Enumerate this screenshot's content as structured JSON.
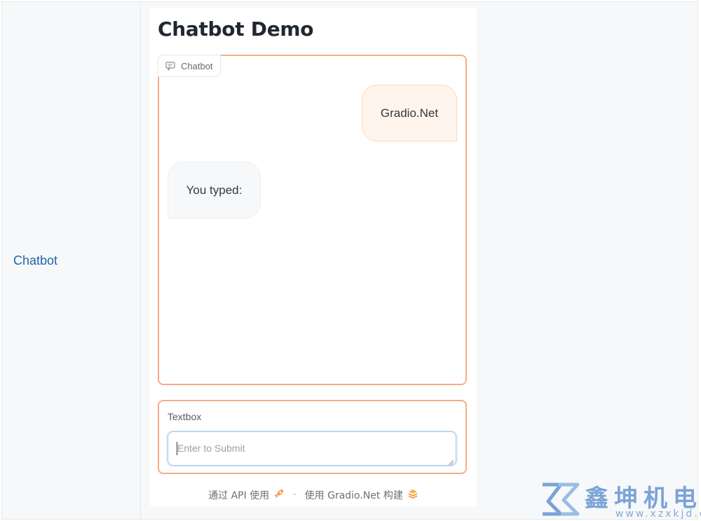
{
  "sidebar": {
    "link_label": "Chatbot"
  },
  "demo": {
    "title": "Chatbot Demo",
    "chatbot": {
      "label": "Chatbot",
      "label_icon": "chat-bubble-icon",
      "messages": [
        {
          "role": "user",
          "text": "Gradio.Net"
        },
        {
          "role": "bot",
          "text": "You typed:"
        }
      ]
    },
    "textbox": {
      "label": "Textbox",
      "placeholder": "Enter to Submit",
      "value": ""
    },
    "footer": {
      "api_text": "通过 API 使用",
      "api_icon": "rocket-icon",
      "separator": "·",
      "built_text": "使用 Gradio.Net 构建",
      "built_icon": "logo-icon"
    }
  },
  "watermark": {
    "brand_text": "鑫坤机电",
    "url_text": "www.xzxkjd.com",
    "logo_icon": "xz-logo-icon"
  },
  "colors": {
    "accent_border": "#f3ae85",
    "user_bubble": "#fff5ec",
    "bot_bubble": "#f7f8fa",
    "link": "#2463a8",
    "focus_border": "#9cc5f0"
  }
}
